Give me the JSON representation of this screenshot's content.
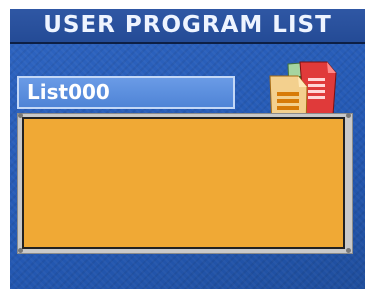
{
  "header": {
    "title": "USER PROGRAM LIST"
  },
  "list": {
    "name": "List000",
    "items": []
  },
  "icon": {
    "name": "documents-icon"
  },
  "colors": {
    "header_bg": "#2f57a4",
    "panel_bg": "#f0a935",
    "tab_bg": "#5b8ede",
    "body_bg": "#2459b4"
  }
}
